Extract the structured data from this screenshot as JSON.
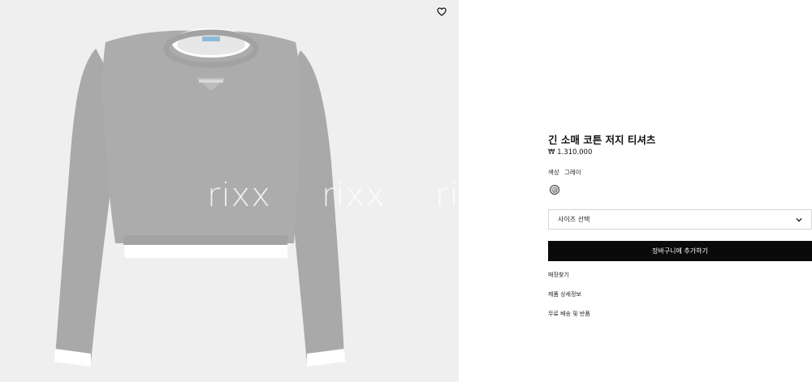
{
  "gallery": {
    "watermarks": [
      "rixx",
      "rixx",
      "rixx"
    ],
    "wishlist_icon": "heart-outline-icon"
  },
  "product": {
    "title": "긴 소매 코튼 저지 티셔츠",
    "price": "₩ 1.310.000",
    "color_label": "색상",
    "color_value": "그레이",
    "swatch_color": "#9a9a9a",
    "size_placeholder": "사이즈 선택",
    "add_to_cart": "장바구니에 추가하기"
  },
  "links": {
    "find_store": "매장찾기",
    "details": "제품 상세정보",
    "shipping": "무료 배송 및 반품"
  }
}
